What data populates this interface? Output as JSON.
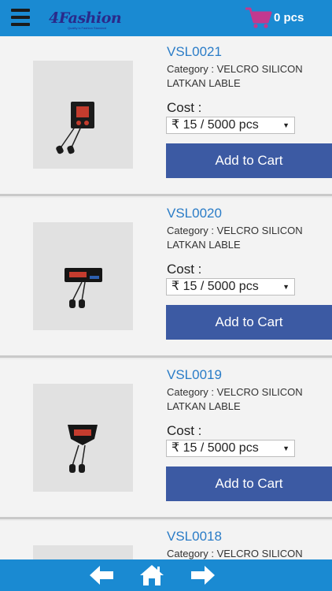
{
  "header": {
    "logo_text": "4Fashion",
    "logo_sub": "Quality is Fashion Standard",
    "cart_count": "0 pcs",
    "icons": {
      "menu": "menu-icon",
      "cart": "cart-icon"
    },
    "colors": {
      "bar": "#1a8ad2",
      "cart": "#c2398f"
    }
  },
  "products": [
    {
      "code": "VSL0021",
      "category": "Category : VELCRO SILICON LATKAN LABLE",
      "cost_label": "Cost :",
      "price": "₹ 15 / 5000 pcs",
      "button": "Add to Cart"
    },
    {
      "code": "VSL0020",
      "category": "Category : VELCRO SILICON LATKAN LABLE",
      "cost_label": "Cost :",
      "price": "₹ 15 / 5000 pcs",
      "button": "Add to Cart"
    },
    {
      "code": "VSL0019",
      "category": "Category : VELCRO SILICON LATKAN LABLE",
      "cost_label": "Cost :",
      "price": "₹ 15 / 5000 pcs",
      "button": "Add to Cart"
    },
    {
      "code": "VSL0018",
      "category": "Category : VELCRO SILICON",
      "cost_label": "",
      "price": "",
      "button": ""
    }
  ],
  "footer": {
    "icons": [
      "back-arrow-icon",
      "home-icon",
      "forward-arrow-icon"
    ]
  }
}
